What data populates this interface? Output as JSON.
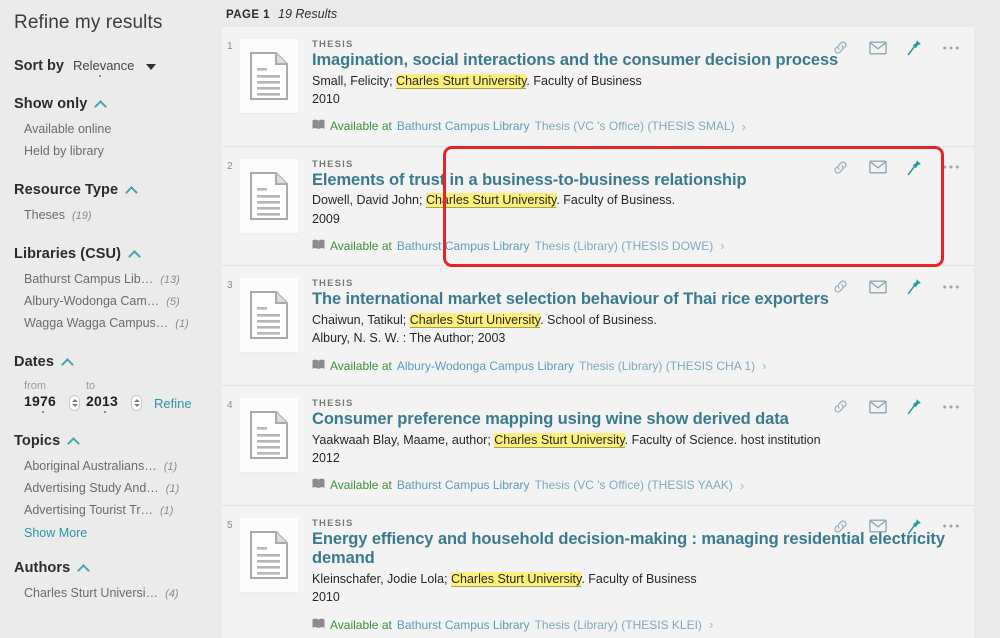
{
  "sidebar": {
    "title": "Refine my results",
    "sort": {
      "label": "Sort by",
      "value": "Relevance",
      "caret": "chevron-down-icon"
    },
    "sections": [
      {
        "name": "show-only",
        "title": "Show only",
        "items": [
          {
            "label": "Available online",
            "count": ""
          },
          {
            "label": "Held by library",
            "count": ""
          }
        ],
        "show_more": ""
      },
      {
        "name": "resource-type",
        "title": "Resource Type",
        "items": [
          {
            "label": "Theses",
            "count": "(19)"
          }
        ],
        "show_more": ""
      },
      {
        "name": "libraries-csu",
        "title": "Libraries (CSU)",
        "items": [
          {
            "label": "Bathurst Campus Lib…",
            "count": "(13)"
          },
          {
            "label": "Albury-Wodonga Cam…",
            "count": "(5)"
          },
          {
            "label": "Wagga Wagga Campus…",
            "count": "(1)"
          }
        ],
        "show_more": ""
      },
      {
        "name": "topics",
        "title": "Topics",
        "items": [
          {
            "label": "Aboriginal Australians…",
            "count": "(1)"
          },
          {
            "label": "Advertising Study And…",
            "count": "(1)"
          },
          {
            "label": "Advertising Tourist Tr…",
            "count": "(1)"
          }
        ],
        "show_more": "Show More"
      },
      {
        "name": "authors",
        "title": "Authors",
        "items": [
          {
            "label": "Charles Sturt Universi…",
            "count": "(4)"
          }
        ],
        "show_more": ""
      }
    ],
    "dates": {
      "title": "Dates",
      "from_label": "from",
      "to_label": "to",
      "from_value": "1976",
      "to_value": "2013",
      "refine_label": "Refine"
    }
  },
  "results_header": {
    "page_label": "PAGE 1",
    "count_label": "19 Results"
  },
  "colors": {
    "accent_teal": "#2a96a5",
    "title_blue": "#3b7a8c",
    "highlight_yellow": "#fdf07a",
    "available_green": "#3d8f3d",
    "selection_red": "#ec2027"
  },
  "actions": [
    {
      "icon": "link-icon",
      "label": "Permalink"
    },
    {
      "icon": "envelope-icon",
      "label": "E-mail"
    },
    {
      "icon": "pin-icon",
      "label": "Pin"
    },
    {
      "icon": "ellipsis-icon",
      "label": "More actions"
    }
  ],
  "results": [
    {
      "rank": "1",
      "type": "THESIS",
      "title": "Imagination, social interactions and the consumer decision process",
      "author_pre": "Small, Felicity; ",
      "author_highlight": "Charles Sturt University",
      "author_post": ". Faculty of Business",
      "year": "2010",
      "availability_prefix": "Available at",
      "library": "Bathurst Campus Library",
      "location": "Thesis (VC 's Office) (THESIS SMAL)",
      "selected": false
    },
    {
      "rank": "2",
      "type": "THESIS",
      "title": "Elements of trust in a business-to-business relationship",
      "author_pre": "Dowell, David John; ",
      "author_highlight": "Charles Sturt University",
      "author_post": ". Faculty of Business.",
      "year": "2009",
      "availability_prefix": "Available at",
      "library": "Bathurst Campus Library",
      "location": "Thesis (Library) (THESIS DOWE)",
      "selected": true
    },
    {
      "rank": "3",
      "type": "THESIS",
      "title": "The international market selection behaviour of Thai rice exporters",
      "author_pre": "Chaiwun, Tatikul; ",
      "author_highlight": "Charles Sturt University",
      "author_post": ". School of Business.",
      "year": "Albury, N. S. W. : The Author; 2003",
      "availability_prefix": "Available at",
      "library": "Albury-Wodonga Campus Library",
      "location": "Thesis (Library) (THESIS CHA 1)",
      "selected": false
    },
    {
      "rank": "4",
      "type": "THESIS",
      "title": "Consumer preference mapping using wine show derived data",
      "author_pre": "Yaakwaah Blay, Maame, author; ",
      "author_highlight": "Charles Sturt University",
      "author_post": ". Faculty of Science. host institution",
      "year": "2012",
      "availability_prefix": "Available at",
      "library": "Bathurst Campus Library",
      "location": "Thesis (VC 's Office) (THESIS YAAK)",
      "selected": false
    },
    {
      "rank": "5",
      "type": "THESIS",
      "title": "Energy effiency and household decision-making : managing residential electricity demand",
      "author_pre": "Kleinschafer, Jodie Lola; ",
      "author_highlight": "Charles Sturt University",
      "author_post": ". Faculty of Business",
      "year": "2010",
      "availability_prefix": "Available at",
      "library": "Bathurst Campus Library",
      "location": "Thesis (Library) (THESIS KLEI)",
      "selected": false
    }
  ]
}
